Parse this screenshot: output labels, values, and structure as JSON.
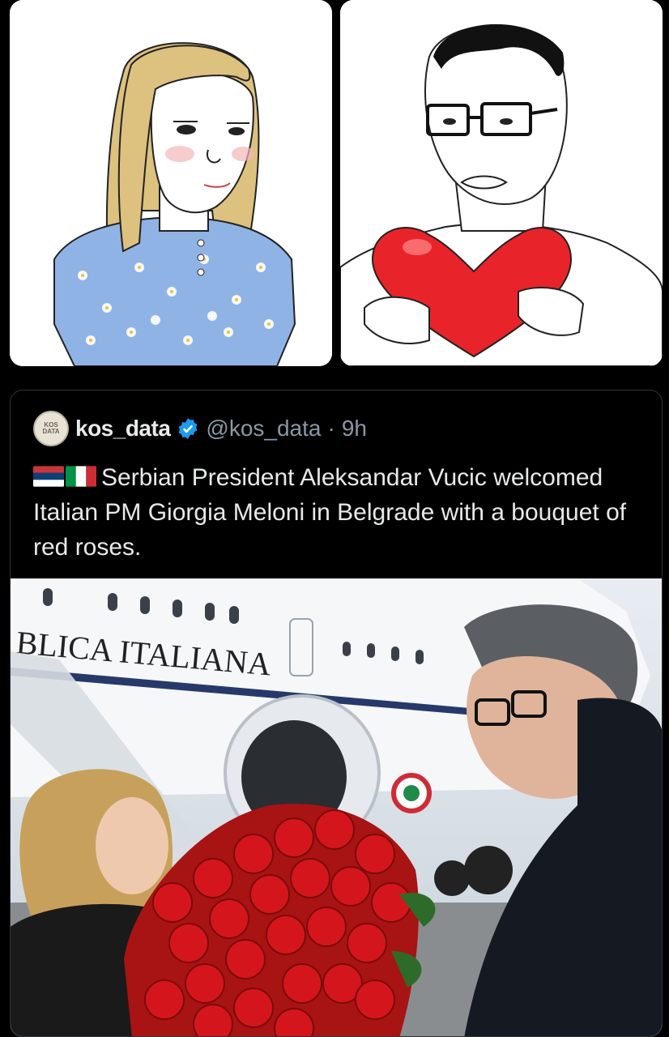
{
  "comic": {
    "left_panel": "woman-with-floral-dress",
    "right_panel": "man-with-glasses-holding-heart"
  },
  "tweet": {
    "display_name": "kos_data",
    "avatar_text": "KOS DATA",
    "handle": "@kos_data",
    "separator": "·",
    "time": "9h",
    "flags": [
      "serbia-flag",
      "italy-flag"
    ],
    "text": "Serbian President Aleksandar Vucic welcomed Italian PM Giorgia Meloni in Belgrade with a bouquet of red roses.",
    "media": {
      "plane_lettering": "BLICA ITALIANA"
    }
  },
  "colors": {
    "background": "#000000",
    "text_primary": "#e7e9ea",
    "text_secondary": "#8b98a5",
    "verified": "#1d9bf0",
    "border": "#2f3336"
  }
}
